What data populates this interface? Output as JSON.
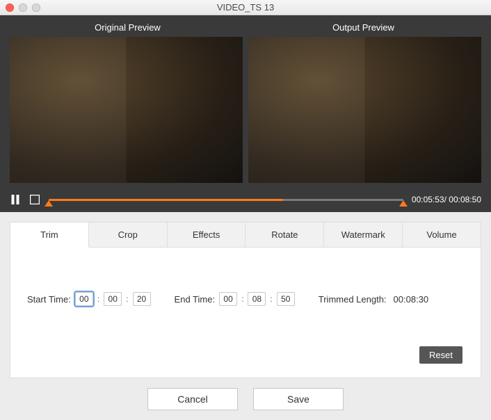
{
  "window": {
    "title": "VIDEO_TS 13"
  },
  "preview": {
    "original_label": "Original Preview",
    "output_label": "Output  Preview"
  },
  "playback": {
    "current_time": "00:05:53",
    "total_time": "00:08:50",
    "separator": "/ ",
    "progress_percent": 66
  },
  "slider": {
    "start_percent": 0,
    "end_percent": 100
  },
  "tabs": {
    "items": [
      "Trim",
      "Crop",
      "Effects",
      "Rotate",
      "Watermark",
      "Volume"
    ],
    "active_index": 0
  },
  "trim": {
    "start_label": "Start Time:",
    "end_label": "End Time:",
    "trimmed_label": "Trimmed Length:",
    "start": {
      "hh": "00",
      "mm": "00",
      "ss": "20"
    },
    "end": {
      "hh": "00",
      "mm": "08",
      "ss": "50"
    },
    "trimmed_value": "00:08:30"
  },
  "buttons": {
    "reset": "Reset",
    "cancel": "Cancel",
    "save": "Save"
  },
  "icons": {
    "pause": "pause-icon",
    "stop": "stop-icon"
  }
}
